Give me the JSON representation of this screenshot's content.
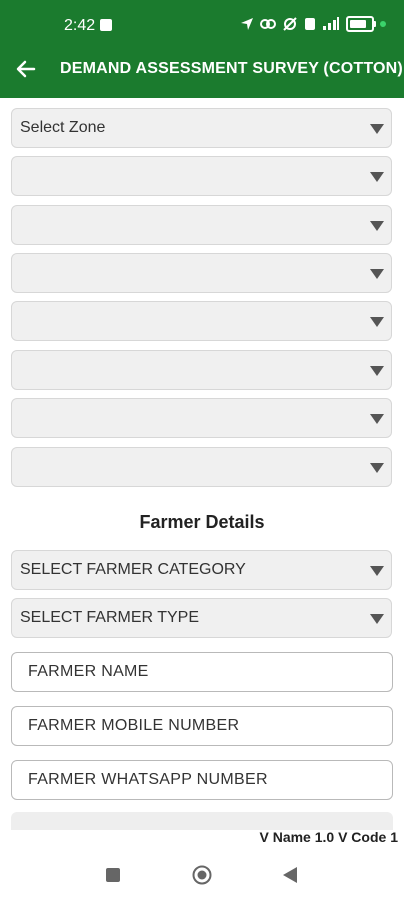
{
  "status_bar": {
    "time": "2:42",
    "icons": [
      "navigation-icon",
      "link-icon",
      "no-internet-icon",
      "sim-icon",
      "signal-icon",
      "battery-icon",
      "notification-dot"
    ]
  },
  "app_bar": {
    "title": "DEMAND ASSESSMENT SURVEY (COTTON)",
    "background": "#1b7b2e"
  },
  "location_dropdowns": [
    {
      "label": "Select Zone"
    },
    {
      "label": ""
    },
    {
      "label": ""
    },
    {
      "label": ""
    },
    {
      "label": ""
    },
    {
      "label": ""
    },
    {
      "label": ""
    },
    {
      "label": ""
    }
  ],
  "farmer_details": {
    "heading": "Farmer Details",
    "dropdowns": [
      {
        "label": "SELECT FARMER CATEGORY"
      },
      {
        "label": "SELECT FARMER TYPE"
      }
    ],
    "inputs": [
      {
        "placeholder": "FARMER NAME",
        "value": ""
      },
      {
        "placeholder": "FARMER MOBILE NUMBER",
        "value": ""
      },
      {
        "placeholder": "FARMER WHATSAPP NUMBER",
        "value": ""
      }
    ]
  },
  "footer": {
    "version": "V Name 1.0 V Code 1"
  }
}
